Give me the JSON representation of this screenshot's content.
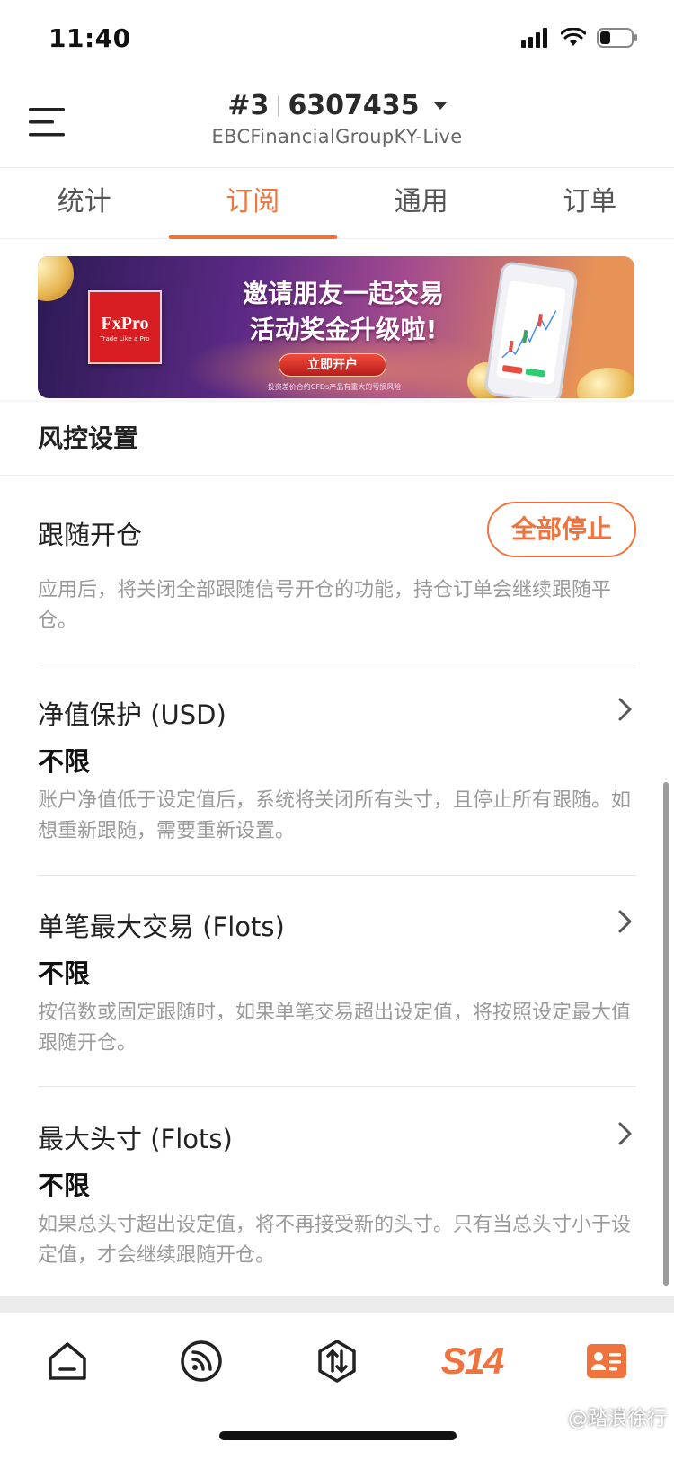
{
  "status_bar": {
    "time": "11:40"
  },
  "header": {
    "account_prefix": "#3",
    "account_number": "6307435",
    "server": "EBCFinancialGroupKY-Live"
  },
  "tabs": [
    {
      "label": "统计",
      "active": false
    },
    {
      "label": "订阅",
      "active": true
    },
    {
      "label": "通用",
      "active": false
    },
    {
      "label": "订单",
      "active": false
    }
  ],
  "banner": {
    "brand": "FxPro",
    "brand_tagline": "Trade Like a Pro",
    "headline_1": "邀请朋友一起交易",
    "headline_2": "活动奖金升级啦!",
    "cta": "立即开户",
    "note": "投资差价合约CFDs产品有重大的亏损风险"
  },
  "section": {
    "title": "风控设置"
  },
  "follow_open": {
    "title": "跟随开仓",
    "button": "全部停止",
    "description": "应用后，将关闭全部跟随信号开仓的功能，持仓订单会继续跟随平仓。"
  },
  "settings": [
    {
      "title": "净值保护 (USD)",
      "value": "不限",
      "description": "账户净值低于设定值后，系统将关闭所有头寸，且停止所有跟随。如想重新跟随，需要重新设置。"
    },
    {
      "title": "单笔最大交易 (Flots)",
      "value": "不限",
      "description": "按倍数或固定跟随时，如果单笔交易超出设定值，将按照设定最大值跟随开仓。"
    },
    {
      "title": "最大头寸 (Flots)",
      "value": "不限",
      "description": "如果总头寸超出设定值，将不再接受新的头寸。只有当总头寸小于设定值，才会继续跟随开仓。"
    }
  ],
  "bottom_nav": {
    "items": [
      "home-icon",
      "signal-icon",
      "trade-icon",
      "s14-logo",
      "profile-card-icon"
    ],
    "logo_text": "S14",
    "active_color": "#f0733d"
  },
  "watermark": "@踏浪徐行",
  "colors": {
    "accent": "#f0733d",
    "muted_text": "#9a9a9a"
  }
}
